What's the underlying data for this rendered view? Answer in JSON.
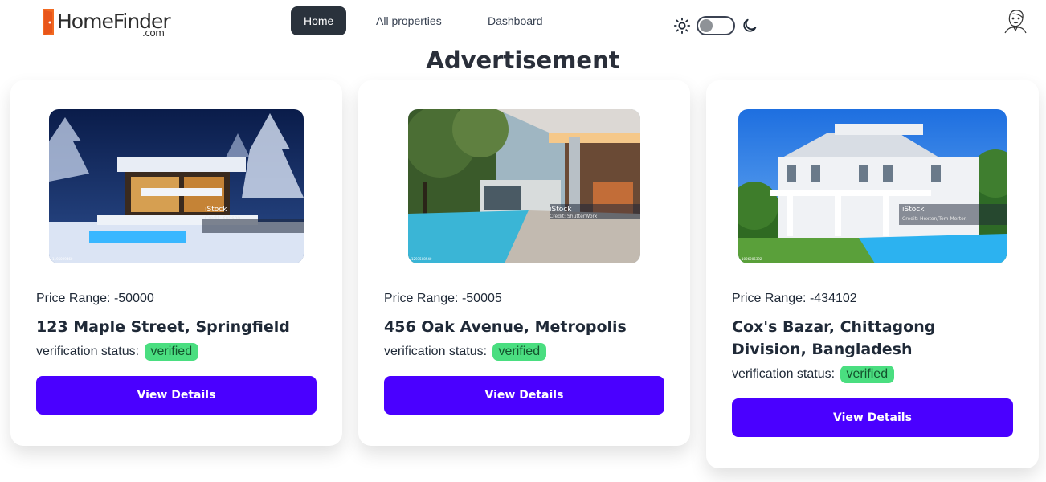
{
  "brand": {
    "name": "HomeFinder",
    "domain": ".com"
  },
  "nav": {
    "links": [
      {
        "label": "Home",
        "active": true
      },
      {
        "label": "All properties",
        "active": false
      },
      {
        "label": "Dashboard",
        "active": false
      }
    ]
  },
  "theme": {
    "light_icon": "sun-icon",
    "dark_icon": "moon-icon",
    "mode": "light"
  },
  "section": {
    "title": "Advertisement"
  },
  "cards": [
    {
      "price_label": "Price Range: -50000",
      "address": "123 Maple Street, Springfield",
      "verification_label": "verification status:",
      "verification_status": "verified",
      "button_label": "View Details",
      "image_watermark": "iStock",
      "image_credit": "Credit: Korisbo",
      "image_id": "1195099460"
    },
    {
      "price_label": "Price Range: -50005",
      "address": "456 Oak Avenue, Metropolis",
      "verification_label": "verification status:",
      "verification_status": "verified",
      "button_label": "View Details",
      "image_watermark": "iStock",
      "image_credit": "Credit: ShutterWorx",
      "image_id": "1293508540"
    },
    {
      "price_label": "Price Range: -434102",
      "address": "Cox's Bazar, Chittagong Division, Bangladesh",
      "verification_label": "verification status:",
      "verification_status": "verified",
      "button_label": "View Details",
      "image_watermark": "iStock",
      "image_credit": "Credit: Hoxton/Tom Merton",
      "image_id": "1026205392"
    }
  ],
  "colors": {
    "primary": "#4a00ff",
    "verified": "#4ade80",
    "nav_active": "#2a323c"
  }
}
